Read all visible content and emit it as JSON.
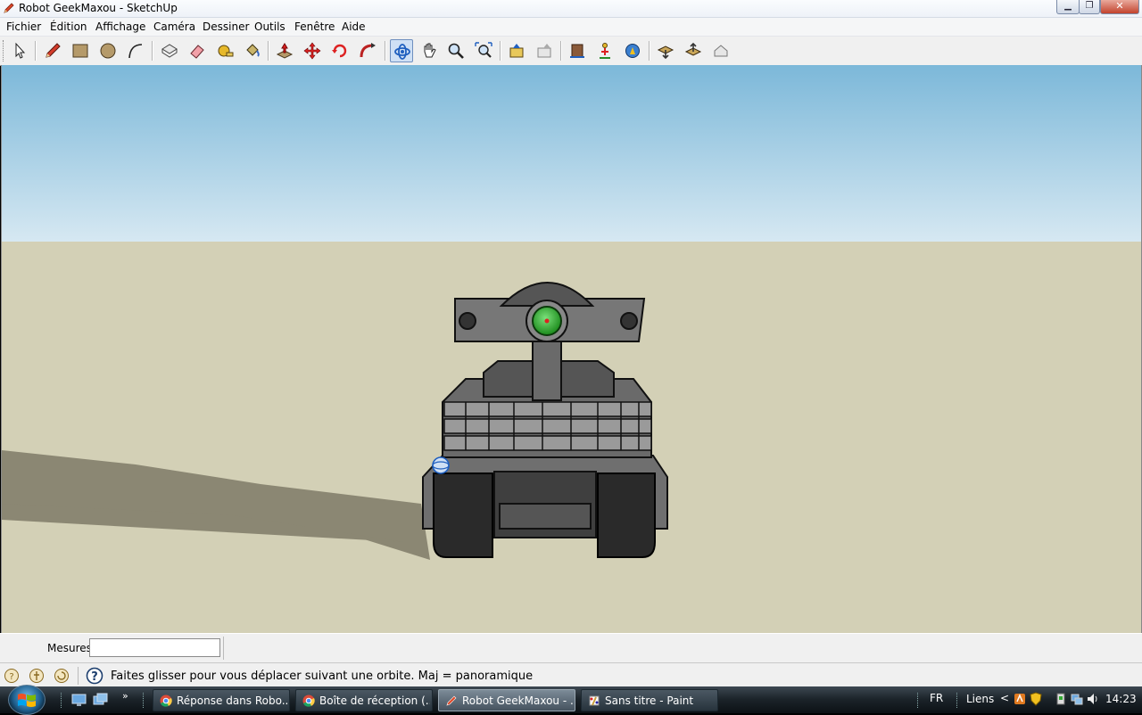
{
  "window": {
    "title": "Robot GeekMaxou - SketchUp",
    "app_icon": "sketchup-pencil-icon",
    "controls": [
      "minimize-icon",
      "maximize-icon",
      "close-icon"
    ]
  },
  "menu": [
    "Fichier",
    "Édition",
    "Affichage",
    "Caméra",
    "Dessiner",
    "Outils",
    "Fenêtre",
    "Aide"
  ],
  "toolbar": {
    "tools": [
      "select-arrow-icon",
      "pencil-line-icon",
      "rectangle-icon",
      "circle-icon",
      "arc-icon",
      "make-component-icon",
      "eraser-icon",
      "tape-measure-icon",
      "paint-bucket-icon",
      "push-pull-icon",
      "move-icon",
      "rotate-icon",
      "follow-me-icon",
      "orbit-icon",
      "pan-hand-icon",
      "zoom-icon",
      "zoom-extents-icon",
      "previous-view-icon",
      "next-view-icon",
      "walk-icon",
      "position-camera-icon",
      "look-around-icon",
      "get-models-icon",
      "share-model-icon",
      "share-component-icon"
    ],
    "active_tool": "orbit-icon"
  },
  "viewport": {
    "sky_color_top": "#7cb8d9",
    "sky_color_bottom": "#d6e8f2",
    "ground_color": "#d3d0b6",
    "model": "robot-tank-model"
  },
  "measurements": {
    "label": "Mesures",
    "value": ""
  },
  "status": {
    "icons": [
      "geo-location-icon",
      "credits-icon",
      "user-icon",
      "help-icon"
    ],
    "text": "Faites glisser pour vous déplacer suivant une orbite.  Maj = panoramique"
  },
  "taskbar": {
    "quick_launch_more": "»",
    "tasks": [
      {
        "label": "Réponse dans Robo...",
        "icon": "chrome-icon",
        "active": false
      },
      {
        "label": "Boîte de réception (...",
        "icon": "chrome-icon",
        "active": false
      },
      {
        "label": "Robot GeekMaxou - ...",
        "icon": "sketchup-icon",
        "active": true
      },
      {
        "label": "Sans titre - Paint",
        "icon": "paint-icon",
        "active": false
      }
    ],
    "tray": {
      "language": "FR",
      "links": "Liens",
      "chevron": "<",
      "time": "14:23"
    }
  }
}
